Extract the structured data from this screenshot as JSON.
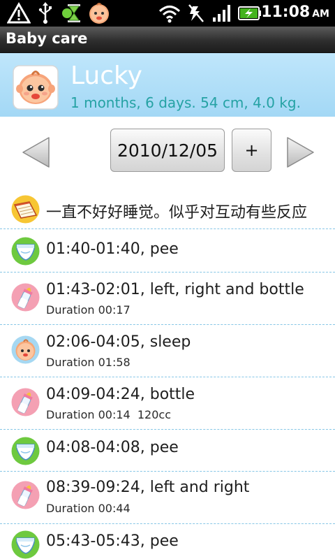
{
  "status_bar": {
    "icons": [
      "warning-icon",
      "usb-icon",
      "hourglass-icon",
      "baby-face-icon",
      "wifi-icon",
      "vibrate-icon",
      "signal-icon",
      "battery-charging-icon"
    ],
    "time": "11:08",
    "ampm": "AM"
  },
  "app": {
    "title": "Baby care"
  },
  "profile": {
    "name": "Lucky",
    "info": "1 months, 6 days. 54 cm, 4.0 kg."
  },
  "date_nav": {
    "date": "2010/12/05",
    "add_label": "+"
  },
  "colors": {
    "profile_bg": "#a3d8f5",
    "info_text": "#25a2a4",
    "divider": "#86c6e6"
  },
  "entries": [
    {
      "icon": "note-icon",
      "title": "一直不好好睡觉。似乎对互动有些反应",
      "sub": ""
    },
    {
      "icon": "diaper-icon",
      "title": "01:40-01:40, pee",
      "sub": ""
    },
    {
      "icon": "bottle-icon",
      "title": "01:43-02:01, left, right and bottle",
      "sub": "Duration 00:17"
    },
    {
      "icon": "sleep-baby-icon",
      "title": "02:06-04:05, sleep",
      "sub": "Duration 01:58"
    },
    {
      "icon": "bottle-icon",
      "title": "04:09-04:24, bottle",
      "sub": "Duration 00:14  120cc"
    },
    {
      "icon": "diaper-icon",
      "title": "04:08-04:08, pee",
      "sub": ""
    },
    {
      "icon": "bottle-icon",
      "title": "08:39-09:24, left and right",
      "sub": "Duration 00:44"
    },
    {
      "icon": "diaper-icon",
      "title": "05:43-05:43, pee",
      "sub": ""
    }
  ]
}
